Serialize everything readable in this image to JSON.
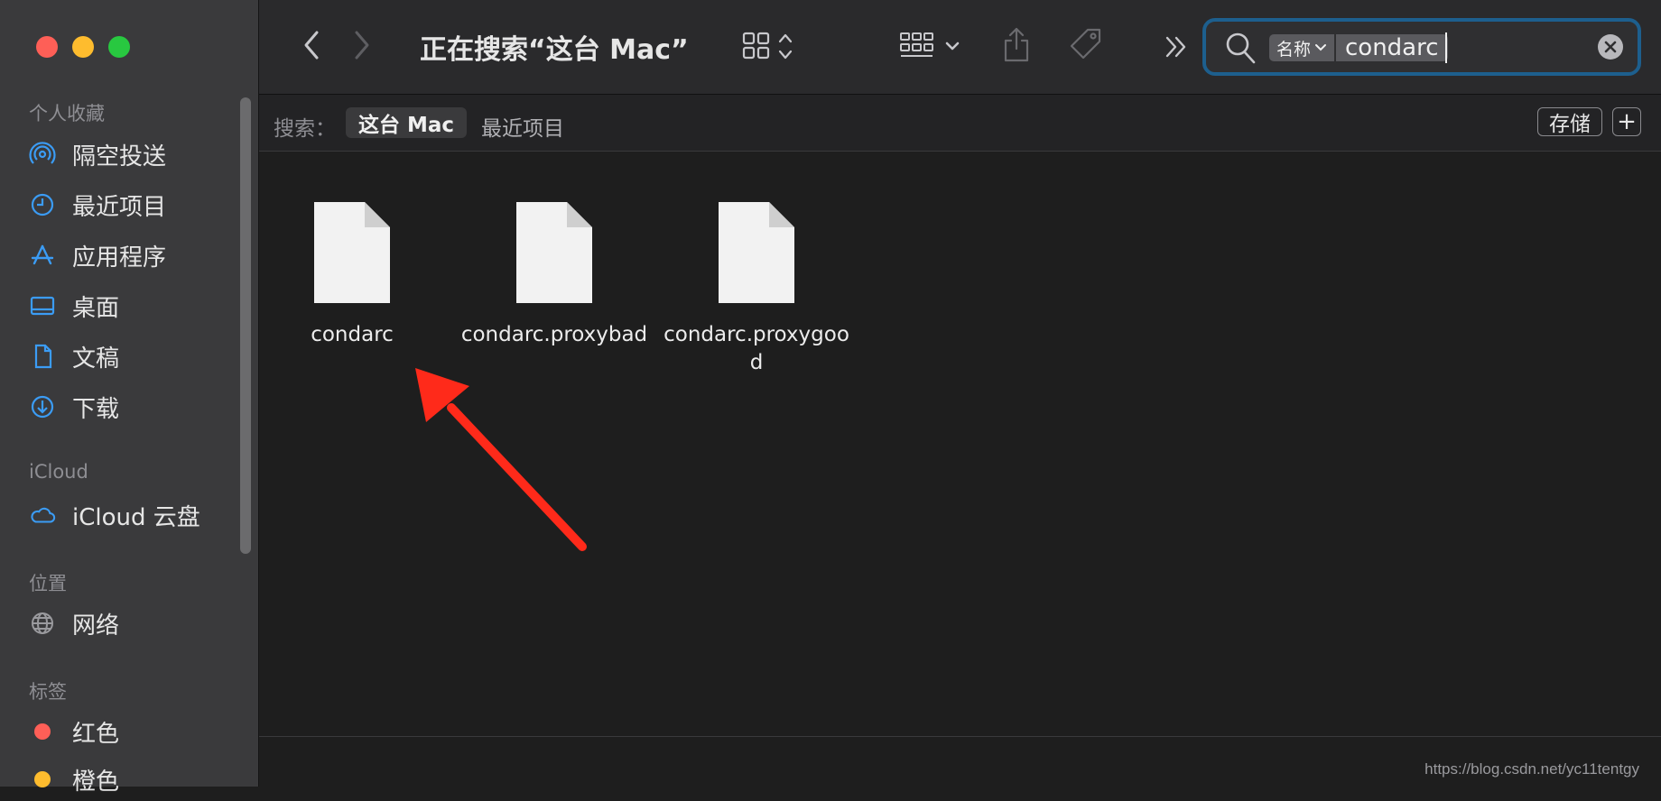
{
  "window": {
    "title": "正在搜索“这台 Mac”"
  },
  "sidebar": {
    "sections": [
      {
        "title": "个人收藏"
      },
      {
        "title": "iCloud"
      },
      {
        "title": "位置"
      },
      {
        "title": "标签"
      }
    ],
    "favorites": [
      {
        "label": "隔空投送",
        "icon": "airdrop-icon"
      },
      {
        "label": "最近项目",
        "icon": "clock-icon"
      },
      {
        "label": "应用程序",
        "icon": "applications-icon"
      },
      {
        "label": "桌面",
        "icon": "desktop-icon"
      },
      {
        "label": "文稿",
        "icon": "document-icon"
      },
      {
        "label": "下载",
        "icon": "download-icon"
      }
    ],
    "icloud": [
      {
        "label": "iCloud 云盘",
        "icon": "cloud-icon"
      }
    ],
    "locations": [
      {
        "label": "网络",
        "icon": "globe-icon"
      }
    ],
    "tags": [
      {
        "label": "红色",
        "color": "#fe5f57"
      },
      {
        "label": "橙色",
        "color": "#febc2e"
      }
    ]
  },
  "toolbar": {
    "search": {
      "category": "名称",
      "value": "condarc"
    }
  },
  "scopebar": {
    "label": "搜索：",
    "scopes": [
      "这台 Mac",
      "最近项目"
    ],
    "save_label": "存储",
    "add_label": "+"
  },
  "files": [
    {
      "name": "condarc"
    },
    {
      "name": "condarc.proxybad"
    },
    {
      "name": "condarc.proxygood"
    }
  ],
  "watermark": "https://blog.csdn.net/yc11tentgy",
  "colors": {
    "accent": "#1d5f8e",
    "annotation_arrow": "#ff2a1a"
  }
}
